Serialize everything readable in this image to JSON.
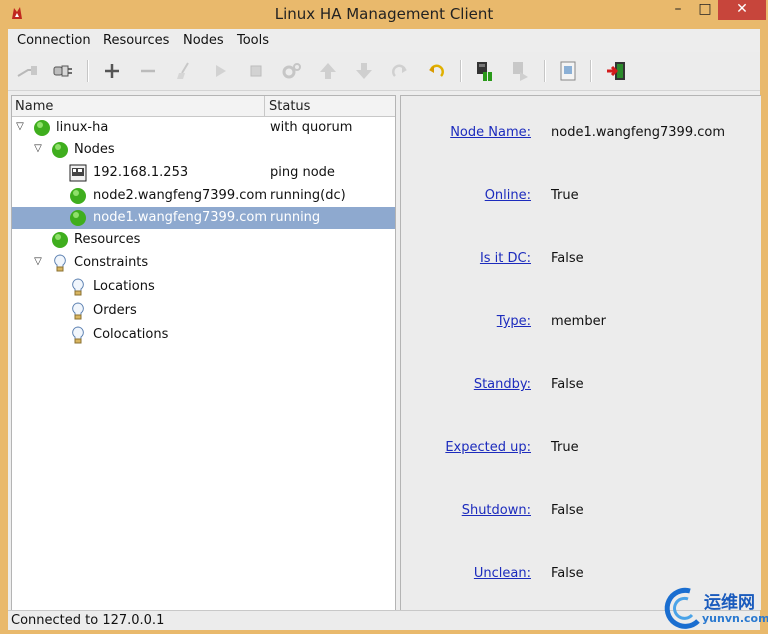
{
  "window": {
    "title": "Linux HA Management Client"
  },
  "menu": [
    "Connection",
    "Resources",
    "Nodes",
    "Tools"
  ],
  "tree": {
    "columns": {
      "name": "Name",
      "status": "Status"
    },
    "rows": [
      {
        "label": "linux-ha",
        "status": "with quorum"
      },
      {
        "label": "Nodes",
        "status": ""
      },
      {
        "label": "192.168.1.253",
        "status": "ping node"
      },
      {
        "label": "node2.wangfeng7399.com",
        "status": "running(dc)"
      },
      {
        "label": "node1.wangfeng7399.com",
        "status": "running",
        "selected": true
      },
      {
        "label": "Resources",
        "status": ""
      },
      {
        "label": "Constraints",
        "status": ""
      },
      {
        "label": "Locations",
        "status": ""
      },
      {
        "label": "Orders",
        "status": ""
      },
      {
        "label": "Colocations",
        "status": ""
      }
    ]
  },
  "details": [
    {
      "label": "Node Name:",
      "value": "node1.wangfeng7399.com"
    },
    {
      "label": "Online:",
      "value": "True"
    },
    {
      "label": "Is it DC:",
      "value": "False"
    },
    {
      "label": "Type:",
      "value": "member"
    },
    {
      "label": "Standby:",
      "value": "False"
    },
    {
      "label": "Expected up:",
      "value": "True"
    },
    {
      "label": "Shutdown:",
      "value": "False"
    },
    {
      "label": "Unclean:",
      "value": "False"
    }
  ],
  "status_bar": "Connected to 127.0.0.1",
  "watermark": {
    "cn": "运维网",
    "en": "yunvn.com"
  },
  "colors": {
    "selection": "#8ea9cf",
    "link": "#1c2bbd",
    "node_green": "#3fae1e"
  }
}
